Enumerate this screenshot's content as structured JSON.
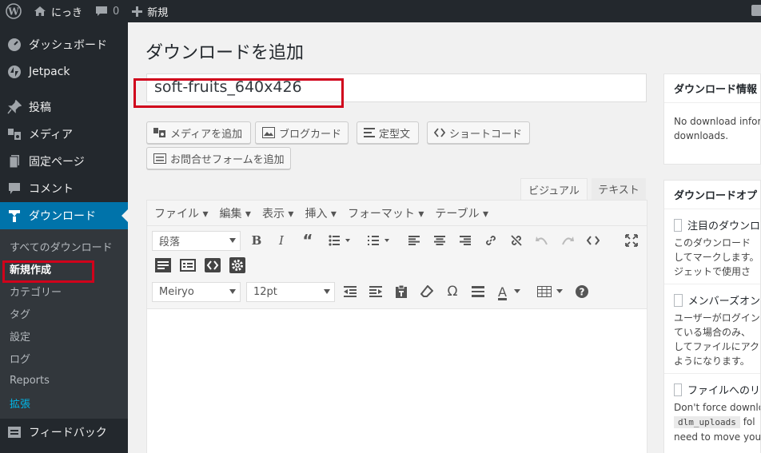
{
  "adminbar": {
    "site_name": "にっき",
    "comment_count": "0",
    "new_label": "新規"
  },
  "sidebar": {
    "dashboard": "ダッシュボード",
    "jetpack": "Jetpack",
    "posts": "投稿",
    "media": "メディア",
    "pages": "固定ページ",
    "comments": "コメント",
    "downloads": "ダウンロード",
    "sub": {
      "all": "すべてのダウンロード",
      "new": "新規作成",
      "categories": "カテゴリー",
      "tags": "タグ",
      "settings": "設定",
      "logs": "ログ",
      "reports": "Reports",
      "extensions": "拡張"
    },
    "feedback": "フィードバック"
  },
  "page": {
    "title": "ダウンロードを追加",
    "post_title_value": "soft-fruits_640x426"
  },
  "buttons": {
    "add_media": "メディアを追加",
    "blog_card": "ブログカード",
    "template": "定型文",
    "shortcode": "ショートコード",
    "contact_form": "お問合せフォームを追加"
  },
  "editor": {
    "tab_visual": "ビジュアル",
    "tab_text": "テキスト",
    "menubar": [
      "ファイル ▾",
      "編集 ▾",
      "表示 ▾",
      "挿入 ▾",
      "フォーマット ▾",
      "テーブル ▾"
    ],
    "format_select": "段落",
    "font_select": "Meiryo",
    "size_select": "12pt",
    "color_letter": "A"
  },
  "right": {
    "info_title": "ダウンロード情報",
    "info_line1": "No download infor",
    "info_line2": "downloads.",
    "opts_title": "ダウンロードオプ",
    "featured_label": "注目のダウンロ",
    "featured_desc": [
      "このダウンロード",
      "してマークします。",
      "ジェットで使用さ"
    ],
    "members_label": "メンバーズオン",
    "members_desc": [
      "ユーザーがログイン",
      "ている場合のみ、",
      "してファイルにアク",
      "ようになります。"
    ],
    "redirect_label": "ファイルへのリ",
    "redirect_desc1": "Don't force downlo",
    "redirect_code": "dlm_uploads",
    "redirect_desc2": "fol",
    "redirect_desc3": "need to move your"
  }
}
